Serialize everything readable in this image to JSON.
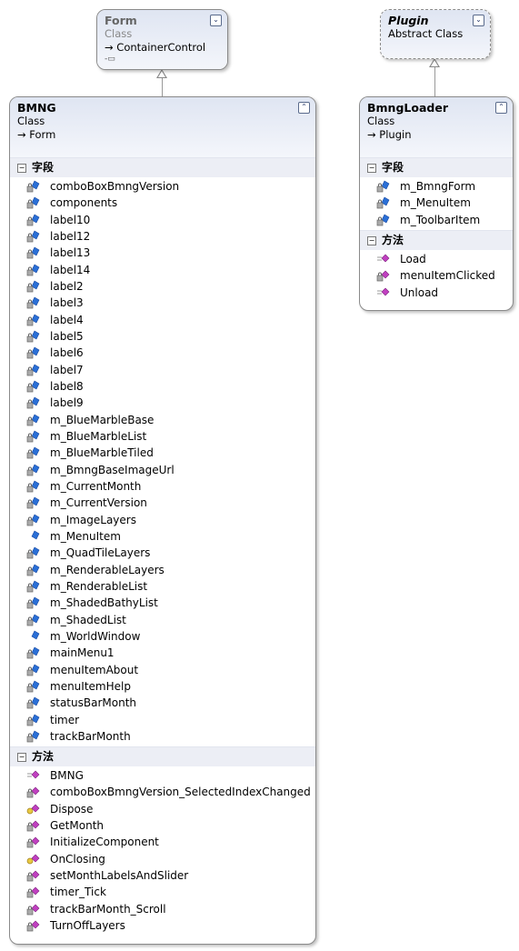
{
  "colors": {
    "field": "#2a6fd6",
    "method": "#c040c0",
    "header": "#dfe5f2",
    "section": "#eceef5"
  },
  "form": {
    "name": "Form",
    "kind": "Class",
    "base": "ContainerControl"
  },
  "plugin": {
    "name": "Plugin",
    "kind": "Abstract Class"
  },
  "bmng": {
    "name": "BMNG",
    "kind": "Class",
    "base": "Form",
    "fields_label": "字段",
    "methods_label": "方法",
    "fields": [
      {
        "name": "comboBoxBmngVersion",
        "access": "private"
      },
      {
        "name": "components",
        "access": "private"
      },
      {
        "name": "label10",
        "access": "private"
      },
      {
        "name": "label12",
        "access": "private"
      },
      {
        "name": "label13",
        "access": "private"
      },
      {
        "name": "label14",
        "access": "private"
      },
      {
        "name": "label2",
        "access": "private"
      },
      {
        "name": "label3",
        "access": "private"
      },
      {
        "name": "label4",
        "access": "private"
      },
      {
        "name": "label5",
        "access": "private"
      },
      {
        "name": "label6",
        "access": "private"
      },
      {
        "name": "label7",
        "access": "private"
      },
      {
        "name": "label8",
        "access": "private"
      },
      {
        "name": "label9",
        "access": "private"
      },
      {
        "name": "m_BlueMarbleBase",
        "access": "private"
      },
      {
        "name": "m_BlueMarbleList",
        "access": "private"
      },
      {
        "name": "m_BlueMarbleTiled",
        "access": "private"
      },
      {
        "name": "m_BmngBaseImageUrl",
        "access": "private"
      },
      {
        "name": "m_CurrentMonth",
        "access": "private"
      },
      {
        "name": "m_CurrentVersion",
        "access": "private"
      },
      {
        "name": "m_ImageLayers",
        "access": "private"
      },
      {
        "name": "m_MenuItem",
        "access": "public"
      },
      {
        "name": "m_QuadTileLayers",
        "access": "private"
      },
      {
        "name": "m_RenderableLayers",
        "access": "private"
      },
      {
        "name": "m_RenderableList",
        "access": "private"
      },
      {
        "name": "m_ShadedBathyList",
        "access": "private"
      },
      {
        "name": "m_ShadedList",
        "access": "private"
      },
      {
        "name": "m_WorldWindow",
        "access": "public"
      },
      {
        "name": "mainMenu1",
        "access": "private"
      },
      {
        "name": "menuItemAbout",
        "access": "private"
      },
      {
        "name": "menuItemHelp",
        "access": "private"
      },
      {
        "name": "statusBarMonth",
        "access": "private"
      },
      {
        "name": "timer",
        "access": "private"
      },
      {
        "name": "trackBarMonth",
        "access": "private"
      }
    ],
    "methods": [
      {
        "name": "BMNG",
        "access": "public"
      },
      {
        "name": "comboBoxBmngVersion_SelectedIndexChanged",
        "access": "private"
      },
      {
        "name": "Dispose",
        "access": "protected"
      },
      {
        "name": "GetMonth",
        "access": "private"
      },
      {
        "name": "InitializeComponent",
        "access": "private"
      },
      {
        "name": "OnClosing",
        "access": "protected"
      },
      {
        "name": "setMonthLabelsAndSlider",
        "access": "private"
      },
      {
        "name": "timer_Tick",
        "access": "private"
      },
      {
        "name": "trackBarMonth_Scroll",
        "access": "private"
      },
      {
        "name": "TurnOffLayers",
        "access": "private"
      }
    ]
  },
  "loader": {
    "name": "BmngLoader",
    "kind": "Class",
    "base": "Plugin",
    "fields_label": "字段",
    "methods_label": "方法",
    "fields": [
      {
        "name": "m_BmngForm",
        "access": "private"
      },
      {
        "name": "m_MenuItem",
        "access": "private"
      },
      {
        "name": "m_ToolbarItem",
        "access": "private"
      }
    ],
    "methods": [
      {
        "name": "Load",
        "access": "public"
      },
      {
        "name": "menuItemClicked",
        "access": "private"
      },
      {
        "name": "Unload",
        "access": "public"
      }
    ]
  }
}
